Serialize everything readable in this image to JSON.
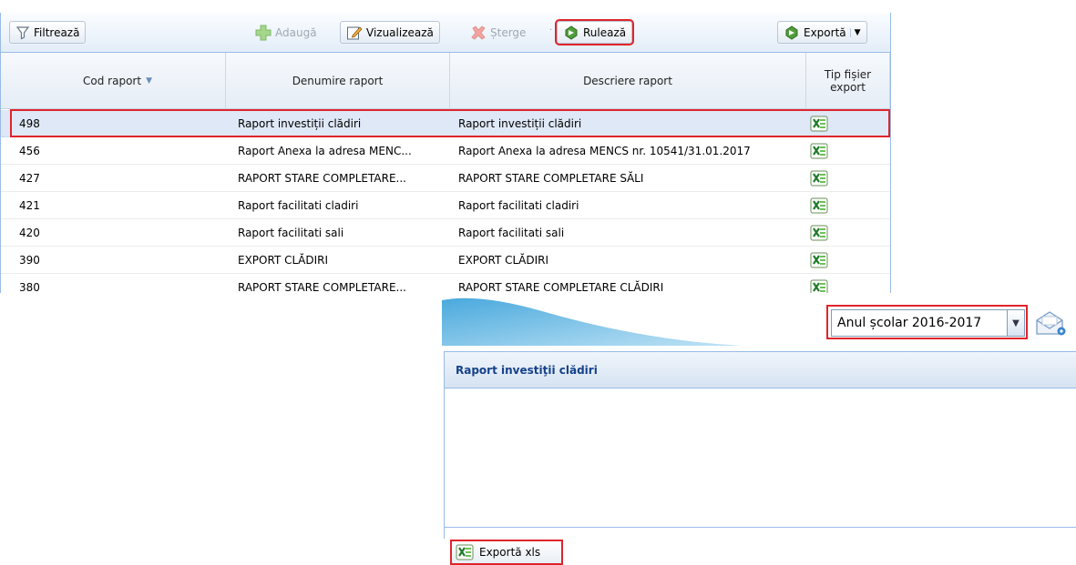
{
  "toolbar": {
    "filter_label": "Filtrează",
    "add_label": "Adaugă",
    "view_label": "Vizualizează",
    "delete_label": "Șterge",
    "run_label": "Rulează",
    "export_label": "Exportă"
  },
  "grid": {
    "columns": [
      "Cod raport",
      "Denumire raport",
      "Descriere raport",
      "Tip fișier export"
    ],
    "rows": [
      {
        "cod": "498",
        "denumire": "Raport investiții clădiri",
        "descriere": "Raport investiții clădiri"
      },
      {
        "cod": "456",
        "denumire": "Raport Anexa la adresa MENC...",
        "descriere": "Raport Anexa la adresa MENCS nr. 10541/31.01.2017"
      },
      {
        "cod": "427",
        "denumire": "RAPORT STARE COMPLETARE...",
        "descriere": "RAPORT STARE COMPLETARE SĂLI"
      },
      {
        "cod": "421",
        "denumire": "Raport facilitati cladiri",
        "descriere": "Raport facilitati cladiri"
      },
      {
        "cod": "420",
        "denumire": "Raport facilitati sali",
        "descriere": "Raport facilitati sali"
      },
      {
        "cod": "390",
        "denumire": "EXPORT CLĂDIRI",
        "descriere": "EXPORT CLĂDIRI"
      },
      {
        "cod": "380",
        "denumire": "RAPORT STARE COMPLETARE...",
        "descriere": "RAPORT STARE COMPLETARE CLĂDIRI"
      }
    ]
  },
  "school_year": {
    "selected": "Anul școlar 2016-2017"
  },
  "report_panel": {
    "title": "Raport investiţii clădiri",
    "export_xls_label": "Exportă xls"
  },
  "icons": [
    "filter-icon",
    "add-icon",
    "view-icon",
    "delete-icon",
    "run-icon",
    "export-icon",
    "xls-icon",
    "mail-icon",
    "dropdown-arrow-icon"
  ],
  "colors": {
    "highlight": "#e0242b",
    "selected_row": "#dfe8f6",
    "panel_border": "#99bbe8",
    "title_text": "#15428b"
  }
}
